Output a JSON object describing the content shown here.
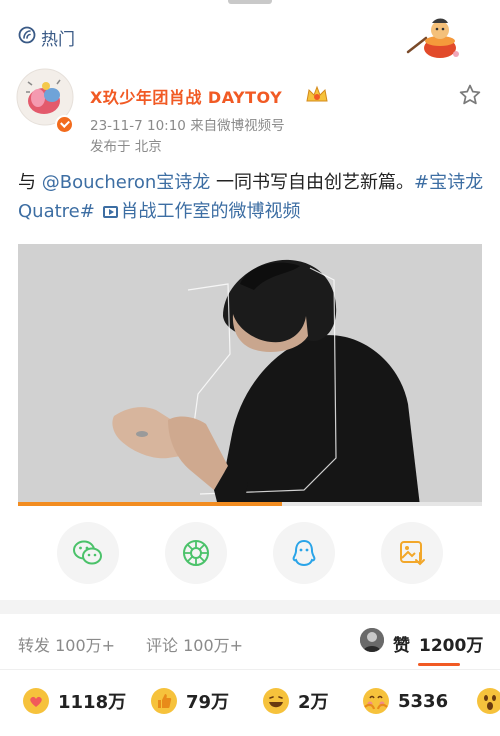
{
  "header": {
    "hot_label": "热门"
  },
  "post": {
    "author_name": "X玖少年团肖战 DAYTOY",
    "timestamp": "23-11-7 10:10",
    "source": "来自微博视频号",
    "location": "发布于 北京",
    "text_prefix": "与 ",
    "mention": "@Boucheron宝诗龙",
    "text_middle": " 一同书写自由创艺新篇。",
    "hashtag": "#宝诗龙 Quatre#",
    "video_link": "肖战工作室的微博视频",
    "video_progress": 0.57
  },
  "stats": {
    "repost": "转发 100万+",
    "comment": "评论 100万+",
    "like_label": "赞",
    "like_count": "1200万"
  },
  "reactions": [
    {
      "icon": "heart-face-icon",
      "count": "1118万",
      "color": "#f6b23c"
    },
    {
      "icon": "thumbs-up-icon",
      "count": "79万",
      "color": "#f6b23c"
    },
    {
      "icon": "laughing-icon",
      "count": "2万",
      "color": "#f6c23c"
    },
    {
      "icon": "hug-icon",
      "count": "5336",
      "color": "#f6b23c"
    },
    {
      "icon": "surprised-icon",
      "count": "",
      "color": "#f6c23c"
    }
  ],
  "share_targets": [
    "wechat-icon",
    "moments-icon",
    "qq-icon",
    "save-image-icon"
  ],
  "colors": {
    "accent": "#f15a24",
    "link": "#3d6ea3",
    "progress": "#f28c20"
  }
}
